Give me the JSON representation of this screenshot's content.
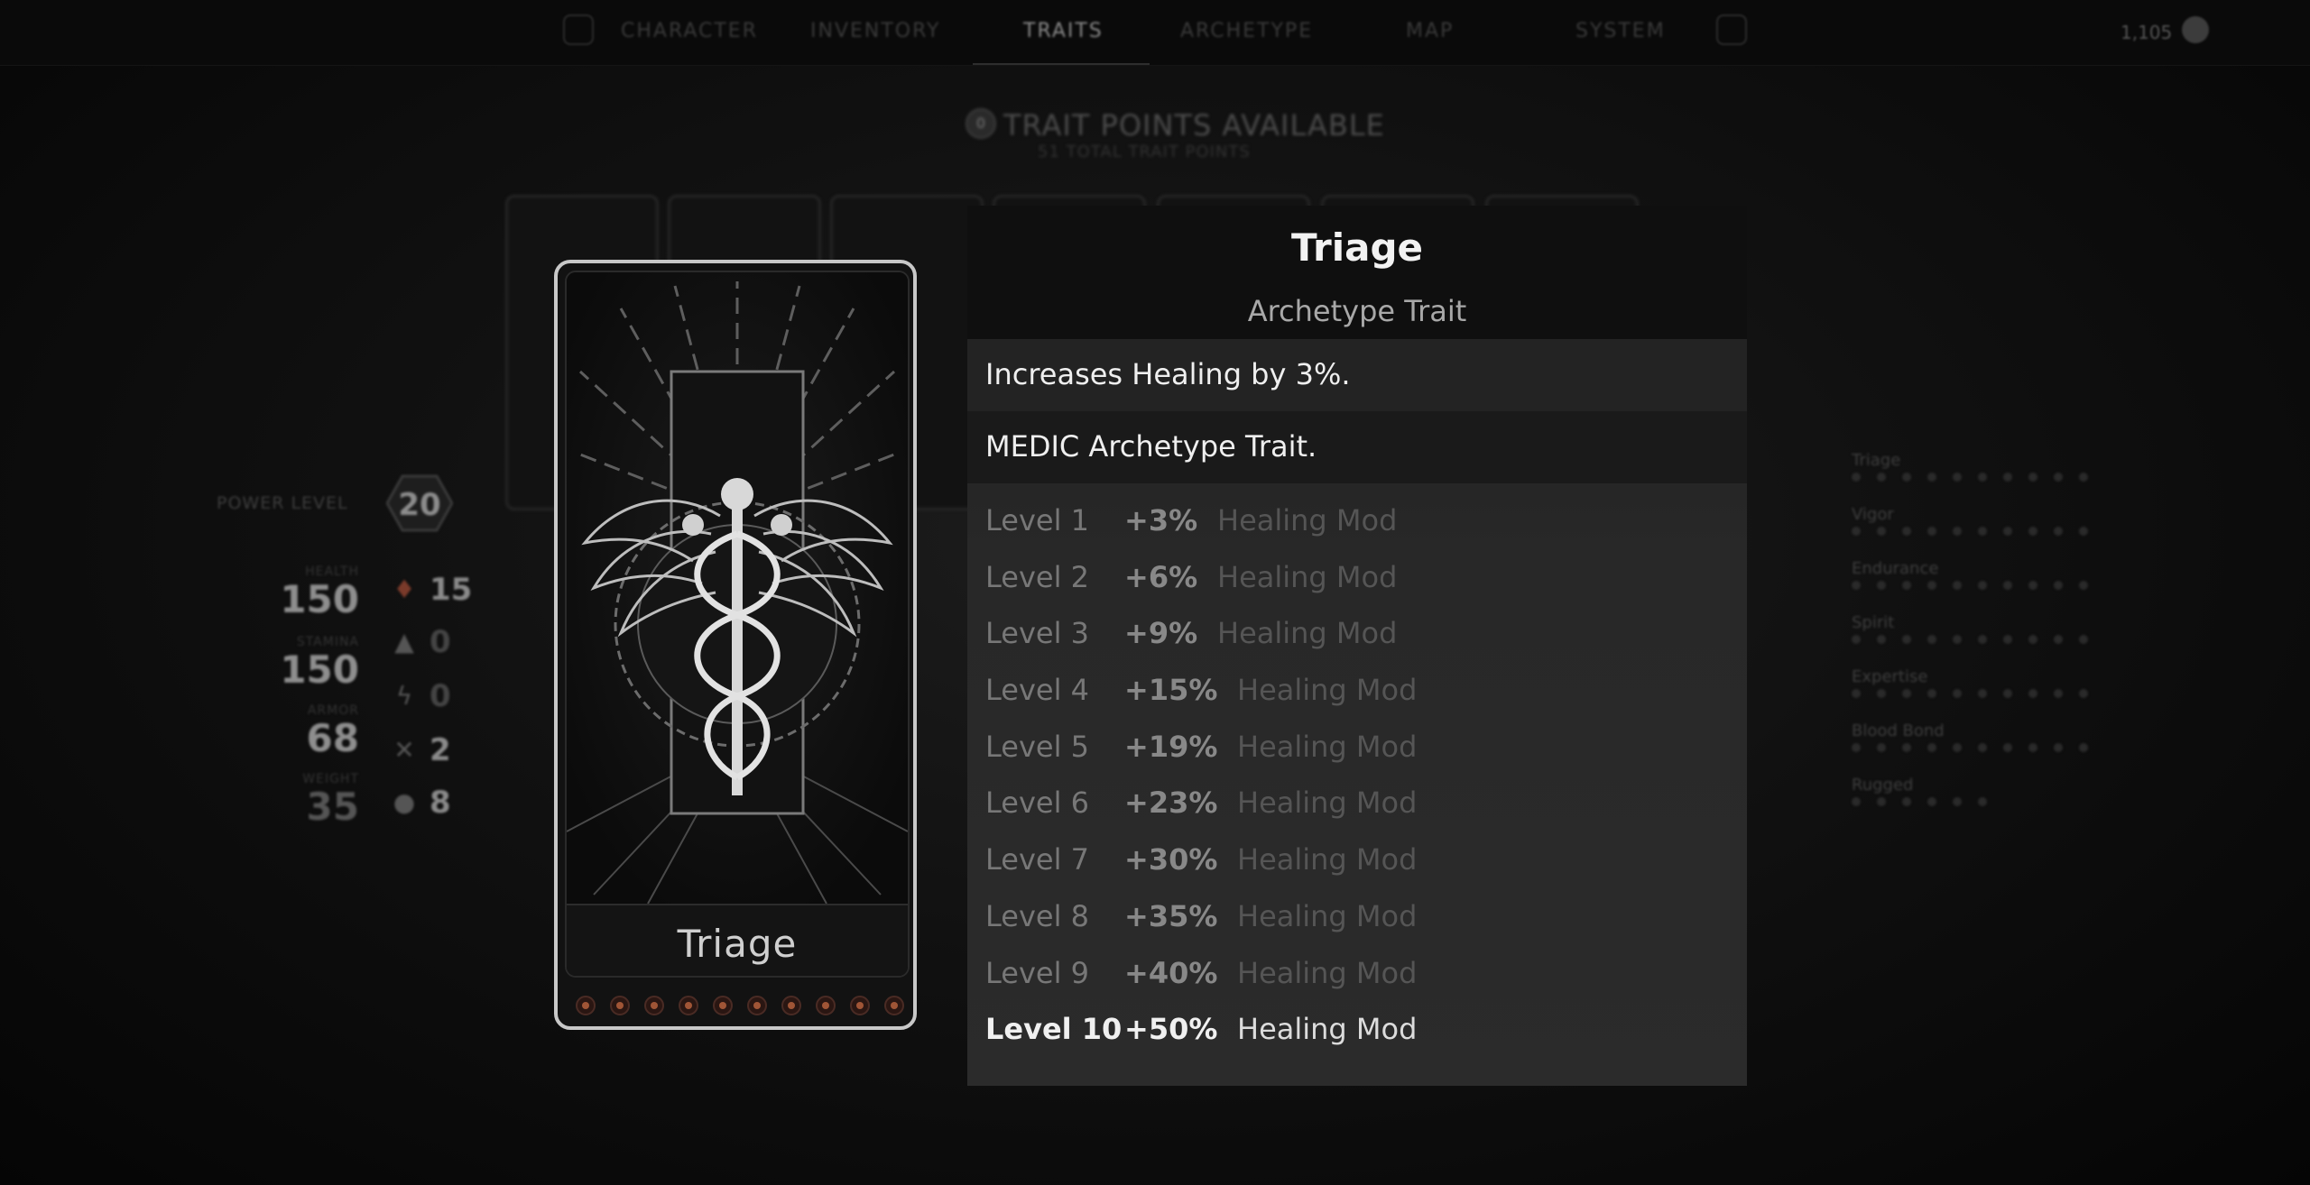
{
  "nav": {
    "tabs": [
      "CHARACTER",
      "INVENTORY",
      "TRAITS",
      "ARCHETYPE",
      "MAP",
      "SYSTEM"
    ],
    "active_tab": "TRAITS",
    "currency_value": "1,105"
  },
  "trait_points": {
    "available_count": "0",
    "available_label": "TRAIT POINTS AVAILABLE",
    "total_label": "51 TOTAL TRAIT POINTS"
  },
  "character": {
    "power_level_label": "POWER LEVEL",
    "power_level": "20",
    "stats": [
      {
        "label": "HEALTH",
        "value": "150"
      },
      {
        "label": "STAMINA",
        "value": "150"
      },
      {
        "label": "ARMOR",
        "value": "68"
      },
      {
        "label": "WEIGHT",
        "value": "35"
      }
    ],
    "resistances": [
      {
        "icon": "bleed-icon",
        "value": "15"
      },
      {
        "icon": "fire-icon",
        "value": "0"
      },
      {
        "icon": "shock-icon",
        "value": "0"
      },
      {
        "icon": "blight-icon",
        "value": "2"
      },
      {
        "icon": "corrosion-icon",
        "value": "8"
      }
    ]
  },
  "trait_list": [
    {
      "name": "Triage",
      "dots": 10
    },
    {
      "name": "Vigor",
      "dots": 10
    },
    {
      "name": "Endurance",
      "dots": 10
    },
    {
      "name": "Spirit",
      "dots": 10
    },
    {
      "name": "Expertise",
      "dots": 10
    },
    {
      "name": "Blood Bond",
      "dots": 10
    },
    {
      "name": "Rugged",
      "dots": 6
    }
  ],
  "card": {
    "name": "Triage",
    "level": 10,
    "max_level": 10,
    "art_icon": "caduceus-icon",
    "accent_color": "#a05536"
  },
  "tooltip": {
    "title": "Triage",
    "subtitle": "Archetype Trait",
    "description": "Increases Healing by 3%.",
    "archetype_note": "MEDIC Archetype Trait.",
    "current_level": 10,
    "levels": [
      {
        "label": "Level 1",
        "value": "+3%",
        "mod": "Healing Mod"
      },
      {
        "label": "Level 2",
        "value": "+6%",
        "mod": "Healing Mod"
      },
      {
        "label": "Level 3",
        "value": "+9%",
        "mod": "Healing Mod"
      },
      {
        "label": "Level 4",
        "value": "+15%",
        "mod": "Healing Mod"
      },
      {
        "label": "Level 5",
        "value": "+19%",
        "mod": "Healing Mod"
      },
      {
        "label": "Level 6",
        "value": "+23%",
        "mod": "Healing Mod"
      },
      {
        "label": "Level 7",
        "value": "+30%",
        "mod": "Healing Mod"
      },
      {
        "label": "Level 8",
        "value": "+35%",
        "mod": "Healing Mod"
      },
      {
        "label": "Level 9",
        "value": "+40%",
        "mod": "Healing Mod"
      },
      {
        "label": "Level 10",
        "value": "+50%",
        "mod": "Healing Mod"
      }
    ]
  }
}
